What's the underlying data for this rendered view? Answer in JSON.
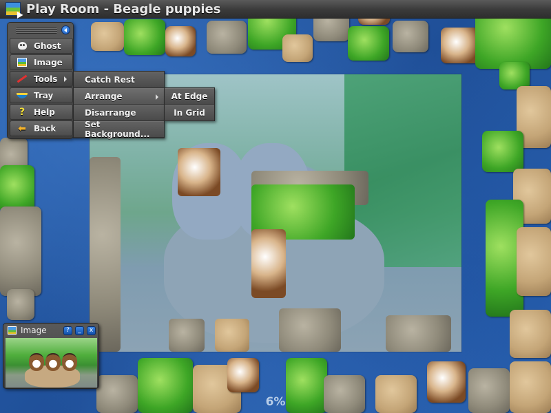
{
  "window": {
    "title": "Play Room - Beagle puppies",
    "icon": "jigsaw-app-icon"
  },
  "main_menu": {
    "collapse_icon": "chevron-left-icon",
    "items": [
      {
        "label": "Ghost",
        "icon": "ghost-icon"
      },
      {
        "label": "Image",
        "icon": "image-icon"
      },
      {
        "label": "Tools",
        "icon": "tools-icon",
        "has_submenu": true
      },
      {
        "label": "Tray",
        "icon": "tray-icon"
      },
      {
        "label": "Help",
        "icon": "help-icon"
      },
      {
        "label": "Back",
        "icon": "back-arrow-icon"
      }
    ]
  },
  "tools_submenu": {
    "items": [
      {
        "label": "Catch Rest"
      },
      {
        "label": "Arrange",
        "has_submenu": true
      },
      {
        "label": "Disarrange"
      },
      {
        "label": "Set Background..."
      }
    ]
  },
  "arrange_submenu": {
    "items": [
      {
        "label": "At Edge"
      },
      {
        "label": "In Grid"
      }
    ]
  },
  "image_window": {
    "title": "Image",
    "buttons": {
      "help": "?",
      "minimize": "_",
      "close": "x"
    }
  },
  "progress": {
    "label": "6%",
    "value": 6
  }
}
